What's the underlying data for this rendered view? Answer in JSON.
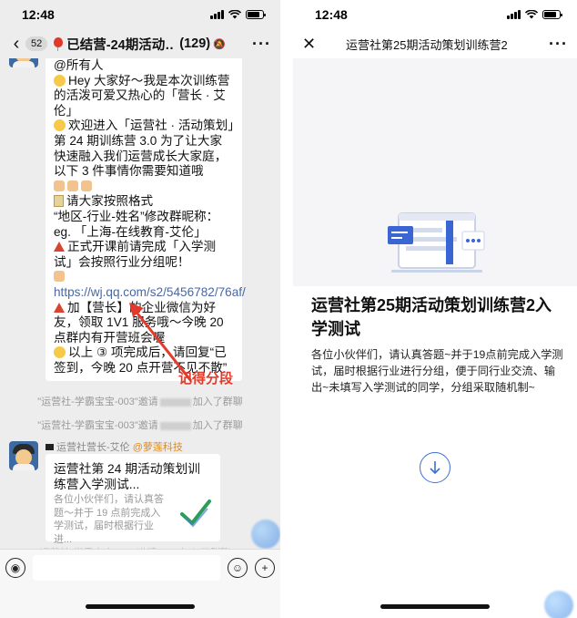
{
  "status_bar": {
    "time": "12:48"
  },
  "left_phone": {
    "header": {
      "unread_count": "52",
      "chat_title": "已结营-24期活动…",
      "member_count": "(129)"
    },
    "message": {
      "lines": [
        "@所有人",
        "Hey 大家好～我是本次训练营的活泼可爱又热心的「营长 · 艾伦」",
        "欢迎进入「运营社 · 活动策划」第 24 期训练营 3.0 为了让大家快速融入我们运营成长大家庭，以下 3 件事情你需要知道哦",
        "请大家按照格式",
        "“地区-行业-姓名”修改群昵称：",
        "eg. 「上海-在线教育-艾伦」",
        "正式开课前请完成「入学测试」会按照行业分组呢！",
        "https://wj.qq.com/s2/5456782/76af/",
        "加【营长】的企业微信为好友，领取 1V1 服务哦～今晚 20 点群内有开营班会喔",
        "以上 ③ 项完成后，请回复“已签到，今晚 20 点开营不见不散”"
      ]
    },
    "system_messages": [
      {
        "inviter": "\"运营社-学霸宝宝-003\"",
        "action_prefix": "邀请",
        "action_suffix": "加入了群聊"
      },
      {
        "inviter": "\"运营社-学霸宝宝-003\"",
        "action_prefix": "邀请",
        "action_suffix": "加入了群聊"
      }
    ],
    "sender": {
      "name": "运营社营长-艾伦",
      "org": "@萝莲科技"
    },
    "card": {
      "title": "运营社第 24 期活动策划训练营入学测试...",
      "desc": "各位小伙伴们，请认真答题～并于 19 点前完成入学测试，届时根据行业进..."
    },
    "annotation": "记得分段",
    "bottom_system": "\"运营社-学霸宝宝-003\"邀请\"Mai\"加入了群聊"
  },
  "right_phone": {
    "page_title": "运营社第25期活动策划训练营2",
    "form_title": "运营社第25期活动策划训练营2入学测试",
    "form_desc": "各位小伙伴们，请认真答题~并于19点前完成入学测试，届时根据行业进行分组，便于同行业交流、输出~未填写入学测试的同学，分组采取随机制~"
  },
  "colors": {
    "chat_bg": "#ededed",
    "accent_red": "#e23b2b",
    "link": "#4a67a3",
    "download_blue": "#3f6fcf"
  },
  "icons": [
    "back-icon",
    "balloon-icon",
    "more-icon",
    "voice-icon",
    "emoji-icon",
    "plus-icon",
    "close-icon",
    "check-icon",
    "download-icon"
  ]
}
